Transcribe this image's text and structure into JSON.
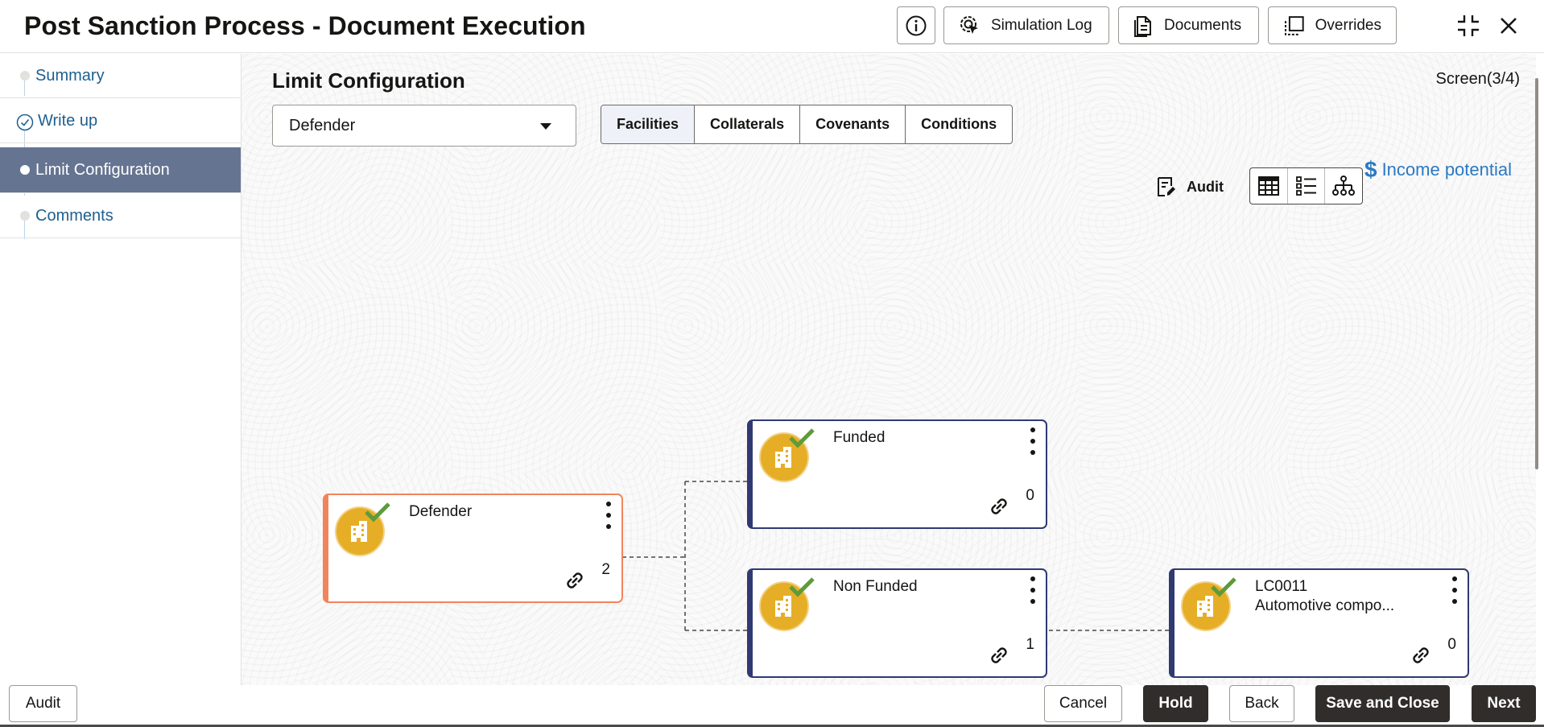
{
  "header": {
    "title": "Post Sanction Process - Document Execution",
    "buttons": {
      "simulation_log": "Simulation Log",
      "documents": "Documents",
      "overrides": "Overrides"
    }
  },
  "sidebar": {
    "items": [
      {
        "label": "Summary",
        "state": "default"
      },
      {
        "label": "Write up",
        "state": "completed"
      },
      {
        "label": "Limit Configuration",
        "state": "active"
      },
      {
        "label": "Comments",
        "state": "default"
      }
    ]
  },
  "main": {
    "section_title": "Limit Configuration",
    "screen_counter": "Screen(3/4)",
    "party_select": {
      "value": "Defender"
    },
    "tabs": [
      {
        "label": "Facilities",
        "selected": true
      },
      {
        "label": "Collaterals",
        "selected": false
      },
      {
        "label": "Covenants",
        "selected": false
      },
      {
        "label": "Conditions",
        "selected": false
      }
    ],
    "income_potential": {
      "symbol": "$",
      "label": "Income potential"
    },
    "audit_label": "Audit",
    "view_modes": [
      "table-view-icon",
      "list-view-icon",
      "hierarchy-view-icon"
    ],
    "active_view": "hierarchy-view-icon"
  },
  "tree": {
    "nodes": [
      {
        "id": "defender",
        "name": "Defender",
        "subtitle": "",
        "count": "2",
        "type": "root"
      },
      {
        "id": "funded",
        "name": "Funded",
        "subtitle": "",
        "count": "0",
        "type": "child"
      },
      {
        "id": "non-funded",
        "name": "Non Funded",
        "subtitle": "",
        "count": "1",
        "type": "child"
      },
      {
        "id": "lc0011",
        "name": "LC0011",
        "subtitle": "Automotive compo...",
        "count": "0",
        "type": "leaf"
      }
    ],
    "colors": {
      "root_border": "#f2845c",
      "node_border": "#2f3a73",
      "avatar": "#e5ae26",
      "check": "#5f9a3a"
    }
  },
  "footer": {
    "audit": "Audit",
    "cancel": "Cancel",
    "hold": "Hold",
    "back": "Back",
    "save_and_close": "Save and Close",
    "next": "Next"
  }
}
